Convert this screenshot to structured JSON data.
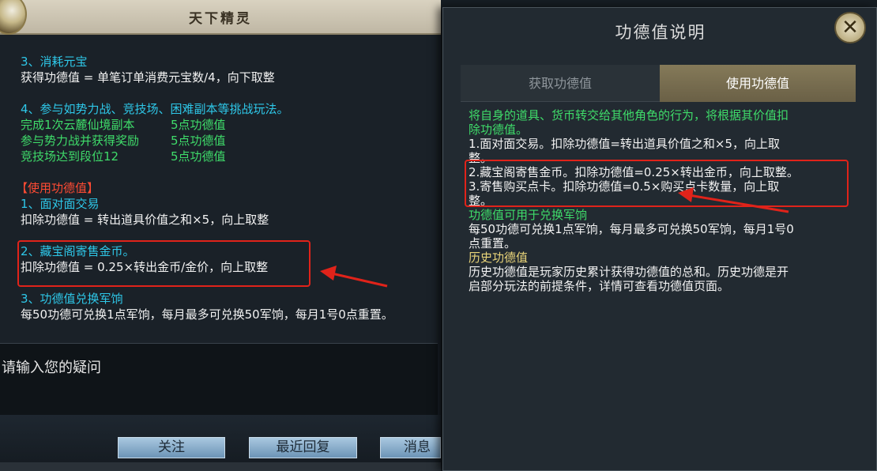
{
  "left_panel": {
    "title": "天下精灵",
    "sections": {
      "s3_heading": "3、消耗元宝",
      "s3_line": "获得功德值 = 单笔订单消费元宝数/4，向下取整",
      "s4_heading": "4、参与如势力战、竞技场、困难副本等挑战玩法。",
      "s4_items": [
        {
          "label": "完成1次云麓仙境副本",
          "points": "5点功德值"
        },
        {
          "label": "参与势力战并获得奖励",
          "points": "5点功德值"
        },
        {
          "label": "竞技场达到段位12",
          "points": "5点功德值"
        }
      ],
      "use_heading": "【使用功德值】",
      "u1_heading": "1、面对面交易",
      "u1_line": "扣除功德值 = 转出道具价值之和×5，向上取整",
      "u2_heading": "2、藏宝阁寄售金币。",
      "u2_line": "扣除功德值 = 0.25×转出金币/金价，向上取整",
      "u3_heading": "3、功德值兑换军饷",
      "u3_line": "每50功德可兑换1点军饷，每月最多可兑换50军饷，每月1号0点重置。"
    },
    "question_placeholder": "请输入您的疑问",
    "buttons": {
      "follow": "关注",
      "recent_reply": "最近回复",
      "message_history": "消息历"
    }
  },
  "right_panel": {
    "title": "功德值说明",
    "close_label": "✕",
    "tabs": [
      "获取功德值",
      "使用功德值"
    ],
    "active_tab": "使用功德值",
    "content": {
      "intro_line1": "将自身的道具、货币转交给其他角色的行为，将根据其价值扣",
      "intro_line2": "除功德值。",
      "item1_line1": "1.面对面交易。扣除功德值=转出道具价值之和×5，向上取",
      "item1_line2": "整。",
      "item2": "2.藏宝阁寄售金币。扣除功德值=0.25×转出金币，向上取整。",
      "item3_line1": "3.寄售购买点卡。扣除功德值=0.5×购买点卡数量，向上取",
      "item3_line2": "整。",
      "exchange_heading": "功德值可用于兑换军饷",
      "exchange_line1": "每50功德可兑换1点军饷，每月最多可兑换50军饷，每月1号0",
      "exchange_line2": "点重置。",
      "history_heading": "历史功德值",
      "history_line1": "历史功德值是玩家历史累计获得功德值的总和。历史功德是开",
      "history_line2": "启部分玩法的前提条件，详情可查看功德值页面。"
    }
  },
  "colors": {
    "cyan_heading": "#2ec7e8",
    "green_text": "#3fdc6a",
    "red_highlight": "#e0231a",
    "yellow_heading": "#ead57a",
    "button_blue": "#6c94b6"
  }
}
